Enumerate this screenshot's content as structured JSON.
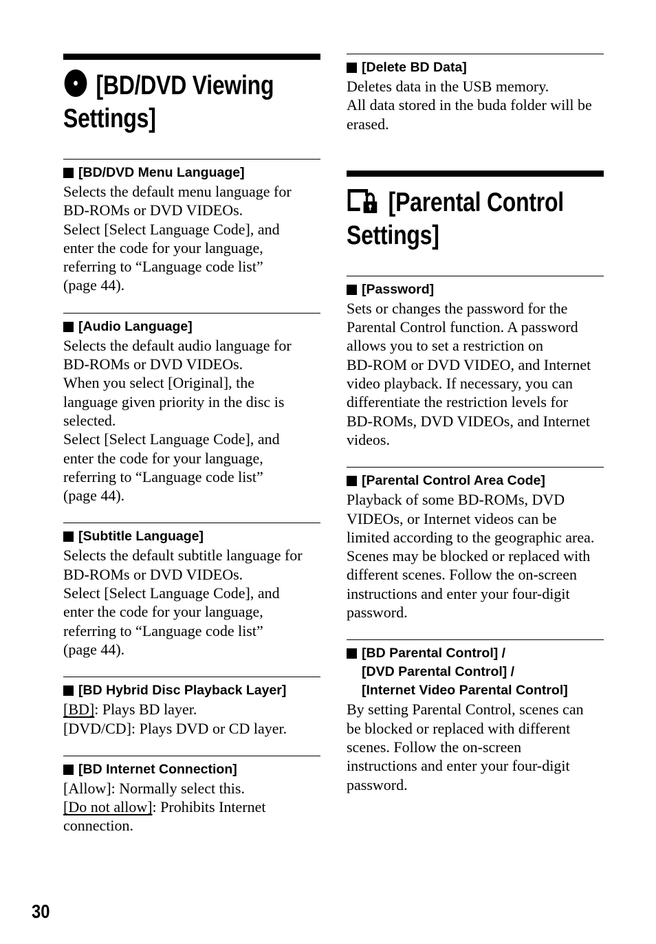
{
  "left_section": {
    "title_line1": "[BD/DVD Viewing",
    "title_line2": "Settings]",
    "icon": "disc-icon",
    "items": [
      {
        "heading": "[BD/DVD Menu Language]",
        "lines": [
          "Selects the default menu language for",
          "BD-ROMs or DVD VIDEOs.",
          "Select [Select Language Code], and",
          "enter the code for your language,",
          "referring to “Language code list”",
          "(page 44)."
        ]
      },
      {
        "heading": "[Audio Language]",
        "lines": [
          "Selects the default audio language for",
          "BD-ROMs or DVD VIDEOs.",
          "When you select [Original], the",
          "language given priority in the disc is",
          "selected.",
          "Select [Select Language Code], and",
          "enter the code for your language,",
          "referring to “Language code list”",
          "(page 44)."
        ]
      },
      {
        "heading": "[Subtitle Language]",
        "lines": [
          "Selects the default subtitle language for",
          "BD-ROMs or DVD VIDEOs.",
          "Select [Select Language Code], and",
          "enter the code for your language,",
          "referring to “Language code list”",
          "(page 44)."
        ]
      },
      {
        "heading": "[BD Hybrid Disc Playback Layer]",
        "options": [
          {
            "label": "[BD]",
            "desc": ": Plays BD layer.",
            "default": true
          },
          {
            "label": "[DVD/CD]",
            "desc": ": Plays DVD or CD layer.",
            "default": false
          }
        ]
      },
      {
        "heading": "[BD Internet Connection]",
        "options": [
          {
            "label": "[Allow]",
            "desc": ": Normally select this.",
            "default": false
          },
          {
            "label": "[Do not allow]",
            "desc": ": Prohibits Internet",
            "default": true
          }
        ],
        "tail": "connection."
      }
    ]
  },
  "right_section": {
    "delete_item": {
      "heading": "[Delete BD Data]",
      "lines": [
        "Deletes data in the USB memory.",
        "All data stored in the buda folder will be",
        "erased."
      ]
    },
    "title_line1": "[Parental Control",
    "title_line2": "Settings]",
    "icon": "parental-lock-icon",
    "items": [
      {
        "heading": "[Password]",
        "lines": [
          "Sets or changes the password for the",
          "Parental Control function. A password",
          "allows you to set a restriction on",
          "BD-ROM or DVD VIDEO, and Internet",
          "video playback. If necessary, you can",
          "differentiate the restriction levels for",
          "BD-ROMs, DVD VIDEOs, and Internet",
          "videos."
        ]
      },
      {
        "heading": "[Parental Control Area Code]",
        "lines": [
          "Playback of some BD-ROMs, DVD",
          "VIDEOs, or Internet videos can be",
          "limited according to the geographic area.",
          "Scenes may be blocked or replaced with",
          "different scenes. Follow the on-screen",
          "instructions and enter your four-digit",
          "password."
        ]
      },
      {
        "heading_lines": [
          "[BD Parental Control] /",
          "[DVD Parental Control] /",
          "[Internet Video Parental Control]"
        ],
        "lines": [
          "By setting Parental Control, scenes can",
          "be blocked or replaced with different",
          "scenes. Follow the on-screen",
          "instructions and enter your four-digit",
          "password."
        ]
      }
    ]
  },
  "page_number": "30"
}
